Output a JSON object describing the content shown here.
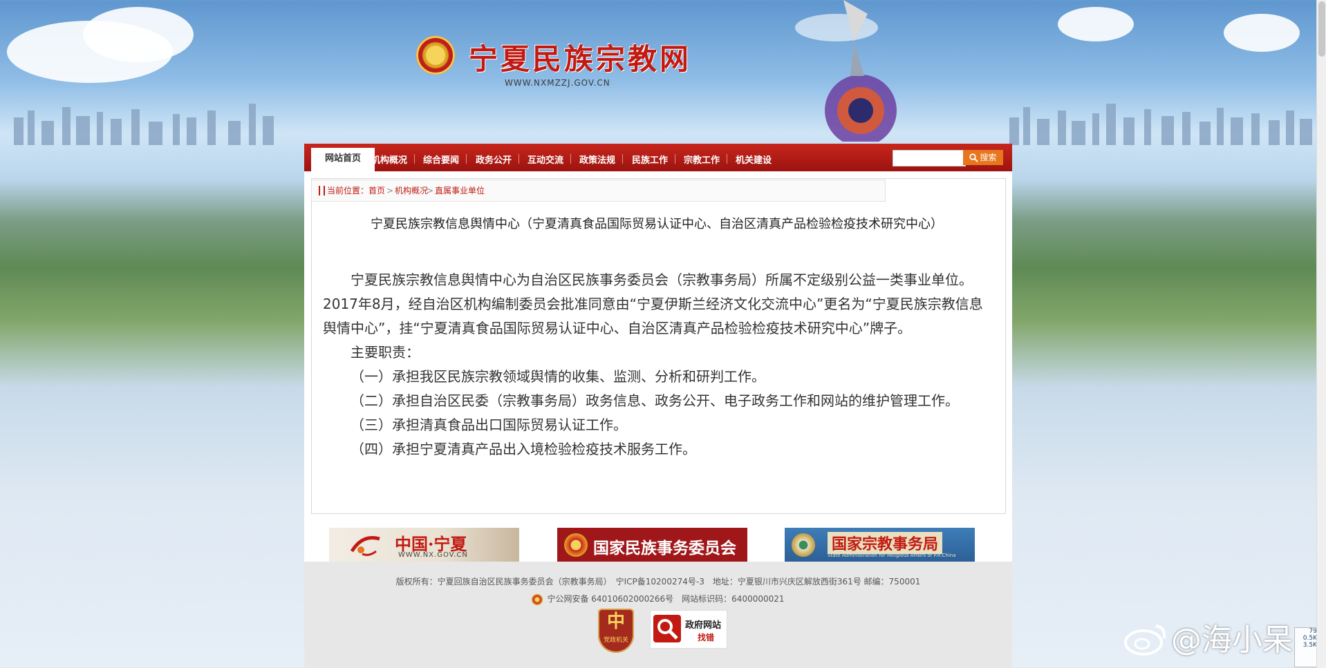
{
  "header": {
    "site_title": "宁夏民族宗教网",
    "site_url": "WWW.NXMZZJ.GOV.CN"
  },
  "nav": {
    "items": [
      {
        "label": "网站首页",
        "active": true
      },
      {
        "label": "机构概况"
      },
      {
        "label": "综合要闻"
      },
      {
        "label": "政务公开"
      },
      {
        "label": "互动交流"
      },
      {
        "label": "政策法规"
      },
      {
        "label": "民族工作"
      },
      {
        "label": "宗教工作"
      },
      {
        "label": "机关建设"
      }
    ],
    "search_placeholder": "",
    "search_label": "搜索"
  },
  "breadcrumb": {
    "prefix": "当前位置：",
    "items": [
      "首页",
      ">",
      "机构概况",
      ">",
      "直属事业单位"
    ]
  },
  "article": {
    "title": "宁夏民族宗教信息舆情中心（宁夏清真食品国际贸易认证中心、自治区清真产品检验检疫技术研究中心）",
    "paragraphs": [
      "宁夏民族宗教信息舆情中心为自治区民族事务委员会（宗教事务局）所属不定级别公益一类事业单位。2017年8月，经自治区机构编制委员会批准同意由“宁夏伊斯兰经济文化交流中心”更名为“宁夏民族宗教信息舆情中心”，挂“宁夏清真食品国际贸易认证中心、自治区清真产品检验检疫技术研究中心”牌子。",
      "主要职责：",
      "（一）承担我区民族宗教领域舆情的收集、监测、分析和研判工作。",
      "（二）承担自治区民委（宗教事务局）政务信息、政务公开、电子政务工作和网站的维护管理工作。",
      "（三）承担清真食品出口国际贸易认证工作。",
      "（四）承担宁夏清真产品出入境检验检疫技术服务工作。"
    ]
  },
  "banners": [
    {
      "title": "中国·宁夏",
      "subtitle": "WWW.NX.GOV.CN"
    },
    {
      "title": "国家民族事务委员会"
    },
    {
      "title": "国家宗教事务局",
      "subtitle": "State Administration for Religious Affairs of P.R.China"
    }
  ],
  "footer": {
    "copyright": "版权所有：宁夏回族自治区民族事务委员会（宗教事务局）　宁ICP备10200274号-3　地址：宁夏银川市兴庆区解放西街361号 邮编：750001",
    "police_record": "宁公网安备 64010602000266号　网站标识码：6400000021",
    "badge1_glyph": "中",
    "badge1_caption": "党政机关",
    "badge2_line1": "政府网站",
    "badge2_line2": "找错"
  },
  "overlay": {
    "watermark": "@海小呆",
    "net_widget_top": "79",
    "net_widget_mid": "0.5K",
    "net_widget_bot": "3.5K"
  },
  "colors": {
    "brand_red": "#c21a12",
    "nav_red": "#b01a14",
    "search_orange": "#e8761e"
  }
}
